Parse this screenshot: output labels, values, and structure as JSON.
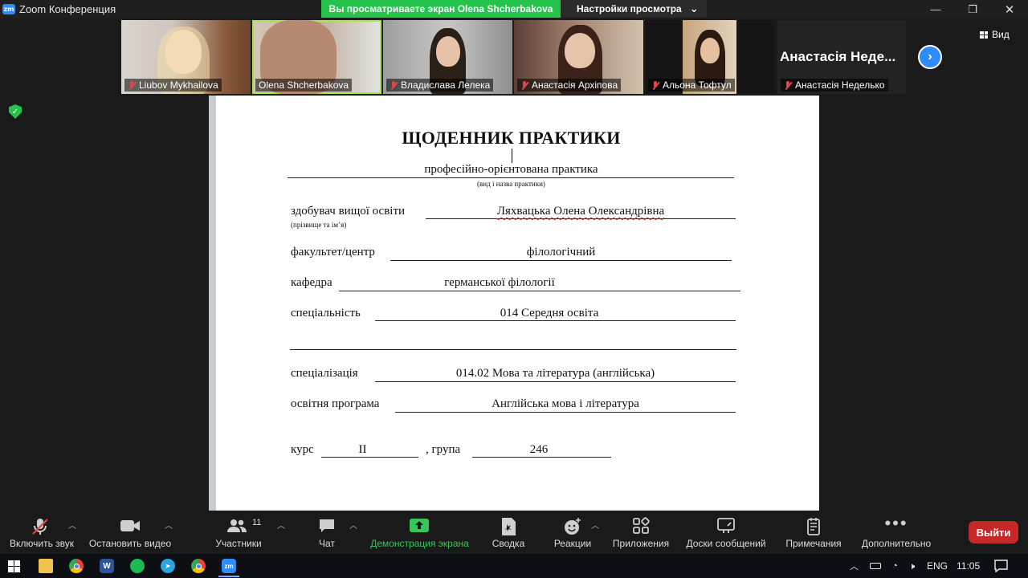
{
  "titlebar": {
    "logo_text": "zm",
    "app_title": "Zoom Конференция",
    "share_banner": "Вы просматриваете экран Olena Shcherbakova",
    "view_settings": "Настройки просмотра",
    "chevron": "⌄",
    "minimize": "—",
    "restore": "❐",
    "close": "✕"
  },
  "participants": [
    {
      "name": "Liubov Mykhailova",
      "muted": true
    },
    {
      "name": "Olena Shcherbakova",
      "muted": false
    },
    {
      "name": "Владислава Лелека",
      "muted": true
    },
    {
      "name": "Анастасія Архіпова",
      "muted": true
    },
    {
      "name": "Альона Тофтул",
      "muted": true
    },
    {
      "name": "Анастасія Неделько",
      "muted": true,
      "display_text": "Анастасія Неде..."
    }
  ],
  "strip": {
    "next_arrow": "›",
    "view_label": "Вид"
  },
  "document": {
    "title": "ЩОДЕННИК ПРАКТИКИ",
    "practice_type": "професійно-орієнтована практика",
    "practice_caption": "(вид і назва практики)",
    "student_label": "здобувач вищої освіти",
    "student_value": "Ляхвацька Олена Олександрівна",
    "student_caption": "(прізвище та ім’я)",
    "faculty_label": "факультет/центр",
    "faculty_value": "філологічний",
    "department_label": "кафедра",
    "department_value": "германської філології",
    "specialty_label": "спеціальність",
    "specialty_value": "014 Середня освіта",
    "specialization_label": "спеціалізація",
    "specialization_value": "014.02 Мова та література (англійська)",
    "program_label": "освітня програма",
    "program_value": "Англійська мова і література",
    "course_label": "курс",
    "course_value": "II",
    "group_label": ", група",
    "group_value": "246"
  },
  "toolbar": {
    "unmute": "Включить звук",
    "stop_video": "Остановить видео",
    "participants": "Участники",
    "participants_count": "11",
    "chat": "Чат",
    "share_screen": "Демонстрация экрана",
    "summary": "Сводка",
    "reactions": "Реакции",
    "apps": "Приложения",
    "whiteboards": "Доски сообщений",
    "notes": "Примечания",
    "more": "Дополнительно",
    "leave": "Выйти"
  },
  "taskbar": {
    "word_letter": "W",
    "zoom_letter": "zm",
    "language": "ENG",
    "time": "11:05"
  },
  "colors": {
    "zoom_blue": "#2d8cff",
    "share_green": "#23c34c",
    "leave_red": "#c62828",
    "mute_red": "#e0464b"
  }
}
